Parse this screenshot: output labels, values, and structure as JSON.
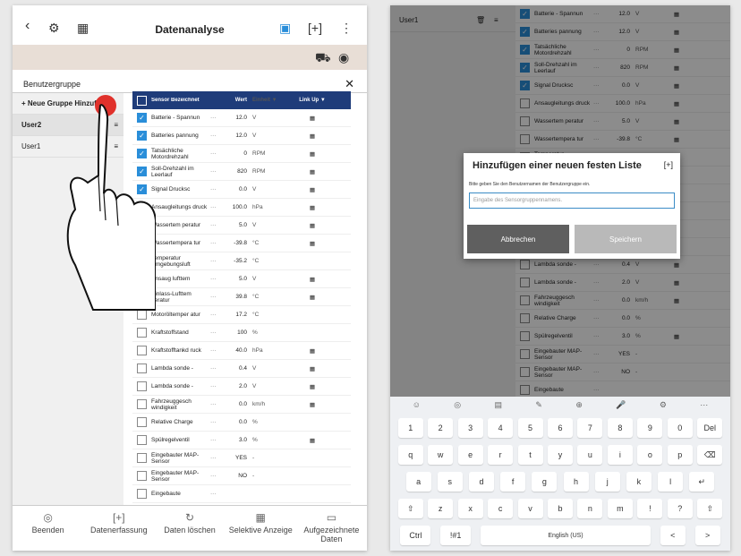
{
  "left": {
    "title": "Datenanalyse",
    "group_label": "Benutzergruppe",
    "new_group": "+ Neue Gruppe Hinzufügen",
    "groups": [
      "User2",
      "User1"
    ],
    "headers": {
      "name": "Sensor Bezeichnet",
      "value": "Wert",
      "unit": "Einheit ▼",
      "link": "Link Up ▼"
    },
    "rows": [
      {
        "name": "Batterie - Spannun",
        "val": "12.0",
        "unit": "V",
        "on": true,
        "link": true
      },
      {
        "name": "Batteries pannung",
        "val": "12.0",
        "unit": "V",
        "on": true,
        "link": true
      },
      {
        "name": "Tatsächliche Motordrehzahl",
        "val": "0",
        "unit": "RPM",
        "on": true,
        "link": true
      },
      {
        "name": "Soll-Drehzahl im Leerlauf",
        "val": "820",
        "unit": "RPM",
        "on": true,
        "link": true
      },
      {
        "name": "Signal Drucksc",
        "val": "0.0",
        "unit": "V",
        "on": true,
        "link": true
      },
      {
        "name": "Ansaugleitungs druck",
        "val": "100.0",
        "unit": "hPa",
        "on": false,
        "link": true
      },
      {
        "name": "Wassertem peratur",
        "val": "5.0",
        "unit": "V",
        "on": false,
        "link": true
      },
      {
        "name": "Wassertempera tur",
        "val": "-39.8",
        "unit": "°C",
        "on": false,
        "link": true
      },
      {
        "name": "Temperatur Umgebungsluft",
        "val": "-35.2",
        "unit": "°C",
        "on": false,
        "link": false
      },
      {
        "name": "Ansaug lufttem",
        "val": "5.0",
        "unit": "V",
        "on": false,
        "link": true
      },
      {
        "name": "Einlass-Lufttem peratur",
        "val": "39.8",
        "unit": "°C",
        "on": false,
        "link": true
      },
      {
        "name": "Motoröltemper atur",
        "val": "17.2",
        "unit": "°C",
        "on": false,
        "link": false
      },
      {
        "name": "Kraftstoffstand",
        "val": "100",
        "unit": "%",
        "on": false,
        "link": false
      },
      {
        "name": "Kraftstofftankd ruck",
        "val": "40.0",
        "unit": "hPa",
        "on": false,
        "link": true
      },
      {
        "name": "Lambda sonde -",
        "val": "0.4",
        "unit": "V",
        "on": false,
        "link": true
      },
      {
        "name": "Lambda sonde -",
        "val": "2.0",
        "unit": "V",
        "on": false,
        "link": true
      },
      {
        "name": "Fahrzeuggesch windigkeit",
        "val": "0.0",
        "unit": "km/h",
        "on": false,
        "link": true
      },
      {
        "name": "Relative Charge",
        "val": "0.0",
        "unit": "%",
        "on": false,
        "link": false
      },
      {
        "name": "Spülregelventil",
        "val": "3.0",
        "unit": "%",
        "on": false,
        "link": true
      },
      {
        "name": "Eingebauter MAP-Sensor",
        "val": "YES",
        "unit": "-",
        "on": false,
        "link": false
      },
      {
        "name": "Eingebauter MAP-Sensor",
        "val": "NO",
        "unit": "-",
        "on": false,
        "link": false
      },
      {
        "name": "Eingebaute",
        "val": "",
        "unit": "",
        "on": false,
        "link": false
      }
    ],
    "bottom": [
      "Beenden",
      "Datenerfassung",
      "Daten löschen",
      "Selektive Anzeige",
      "Aufgezeichnete Daten"
    ]
  },
  "right": {
    "group_item": "User1",
    "dialog": {
      "title": "Hinzufügen einer neuen festen Liste",
      "desc": "Bitte geben Sie den Benutzernamen der Benutzergruppe ein.",
      "placeholder": "Eingabe des Sensorgruppennamens.",
      "cancel": "Abbrechen",
      "save": "Speichern"
    },
    "keyboard": {
      "row1": [
        "1",
        "2",
        "3",
        "4",
        "5",
        "6",
        "7",
        "8",
        "9",
        "0",
        "Del"
      ],
      "row2": [
        "q",
        "w",
        "e",
        "r",
        "t",
        "y",
        "u",
        "i",
        "o",
        "p",
        "⌫"
      ],
      "row3": [
        "a",
        "s",
        "d",
        "f",
        "g",
        "h",
        "j",
        "k",
        "l",
        "↵"
      ],
      "row4": [
        "⇧",
        "z",
        "x",
        "c",
        "v",
        "b",
        "n",
        "m",
        "!",
        "?",
        "⇧"
      ],
      "row5": [
        "Ctrl",
        "!#1",
        "English (US)",
        "<",
        ">"
      ]
    }
  },
  "colors": {
    "accent": "#2a8ed9",
    "header": "#1f3c7a",
    "cancel": "#5f5f5f",
    "save": "#b9b9b9"
  }
}
